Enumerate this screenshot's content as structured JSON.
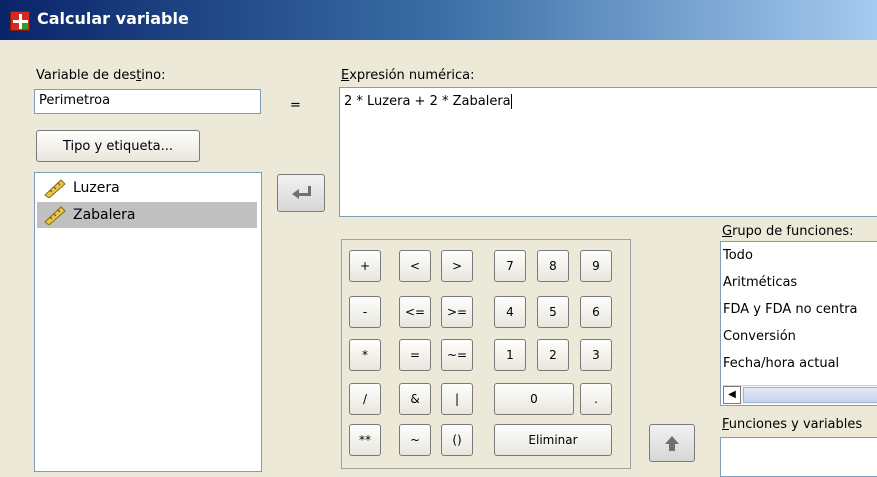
{
  "window": {
    "title": "Calcular variable"
  },
  "target": {
    "label": "Variable de destino:",
    "value": "Perimetroa",
    "type_button": "Tipo y etiqueta..."
  },
  "equals": "=",
  "expression": {
    "label": "Expresión numérica:",
    "value": "2 * Luzera + 2 * Zabalera"
  },
  "variables": [
    {
      "name": "Luzera",
      "icon": "ruler-icon",
      "selected": false
    },
    {
      "name": "Zabalera",
      "icon": "ruler-icon",
      "selected": true
    }
  ],
  "transfer_button": {
    "icon": "arrow-right-icon"
  },
  "keypad": {
    "r1": [
      "+",
      "<",
      ">",
      "7",
      "8",
      "9"
    ],
    "r2": [
      "-",
      "<=",
      ">=",
      "4",
      "5",
      "6"
    ],
    "r3": [
      "*",
      "=",
      "~=",
      "1",
      "2",
      "3"
    ],
    "r4": [
      "/",
      "&",
      "|",
      "0",
      "."
    ],
    "r5": [
      "**",
      "~",
      "()",
      "Eliminar"
    ]
  },
  "up_button": {
    "icon": "arrow-up-icon"
  },
  "function_group": {
    "label": "Grupo de funciones:",
    "items": [
      "Todo",
      "Aritméticas",
      "FDA y FDA no centra",
      "Conversión",
      "Fecha/hora actual"
    ]
  },
  "functions_vars": {
    "label": "Funciones y variables"
  },
  "colors": {
    "titlebar_start": "#0a246a",
    "titlebar_end": "#a6caf0",
    "selection": "#c0c0c0",
    "dialog_bg": "#ece9d8"
  }
}
